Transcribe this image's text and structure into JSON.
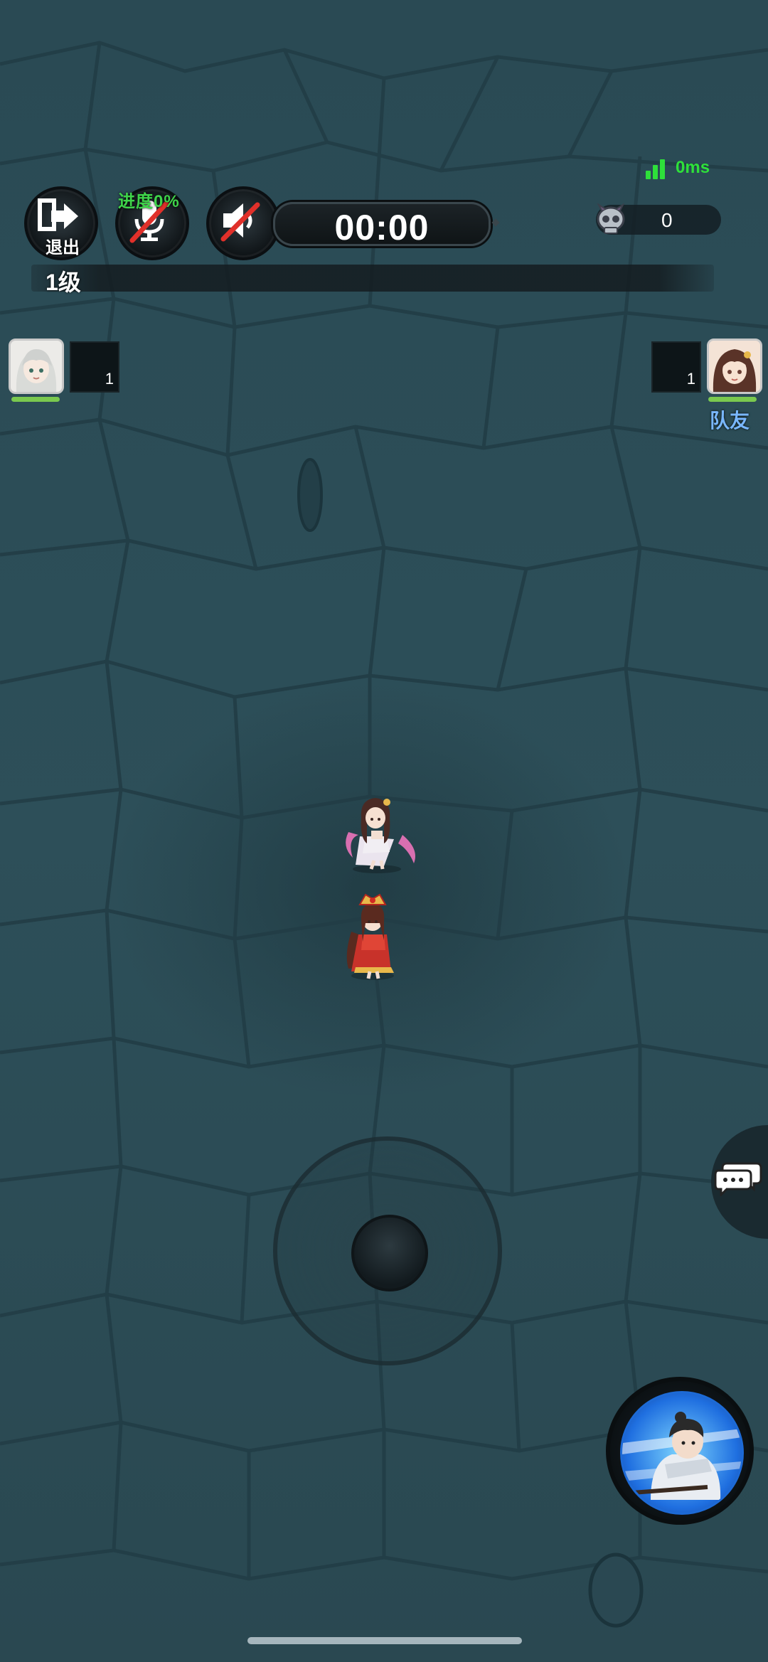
{
  "hud": {
    "exit_label": "退出",
    "progress_label": "进度0%",
    "timer": "00:00",
    "ping": "0ms",
    "kill_count": "0",
    "level": "1级"
  },
  "players": {
    "left": {
      "box_value": "1",
      "hp_fraction": 1.0
    },
    "right": {
      "box_value": "1",
      "hp_fraction": 1.0,
      "tag": "队友"
    }
  },
  "icons": {
    "exit": "exit-door-icon",
    "mic": "mic-muted-icon",
    "sound": "speaker-muted-icon",
    "signal": "signal-bars-icon",
    "kill": "skull-icon",
    "chat": "chat-bubbles-icon"
  },
  "colors": {
    "background": "#2b4b55",
    "signal_green": "#2ee03a",
    "hp_green": "#7ac94f",
    "team_blue": "#79b7ff",
    "mute_red": "#e0302a"
  }
}
